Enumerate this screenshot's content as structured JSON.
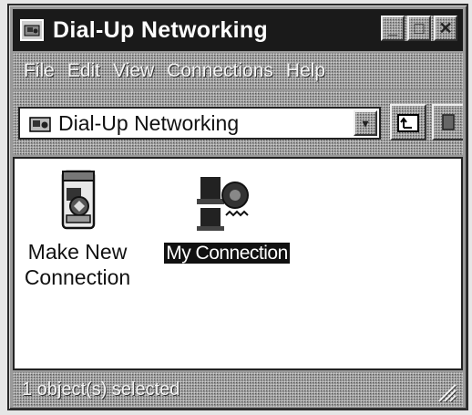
{
  "window": {
    "title": "Dial-Up Networking",
    "controls": {
      "minimize": "_",
      "maximize": "□",
      "close": "✕"
    }
  },
  "menu": {
    "items": [
      "File",
      "Edit",
      "View",
      "Connections",
      "Help"
    ]
  },
  "toolbar": {
    "address_value": "Dial-Up Networking",
    "dropdown_glyph": "▾"
  },
  "content": {
    "items": [
      {
        "label_line1": "Make New",
        "label_line2": "Connection",
        "icon": "make-new-connection-icon",
        "selected": false
      },
      {
        "label": "My Connection",
        "icon": "modem-connection-icon",
        "selected": true
      }
    ]
  },
  "status": {
    "text": "1 object(s) selected"
  },
  "colors": {
    "titlebar": "#1a1a1a",
    "window_frame": "#9a9a9a",
    "selection": "#111111",
    "content_bg": "#ffffff"
  }
}
